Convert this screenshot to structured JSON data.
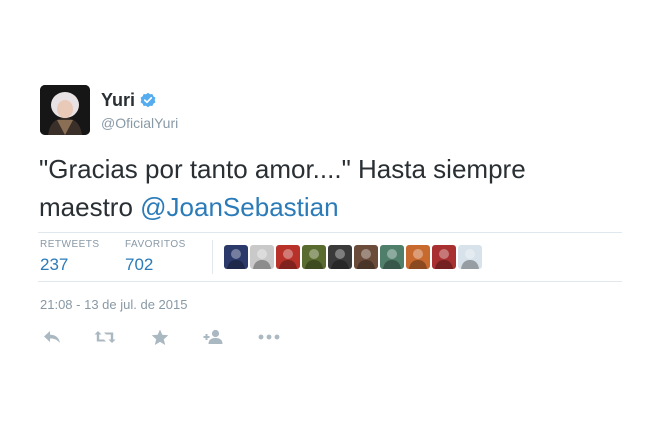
{
  "author": {
    "name": "Yuri",
    "handle": "@OficialYuri",
    "avatar_icon": "profile-photo",
    "verified_icon": "verified-badge-icon"
  },
  "tweet": {
    "text_before": "\"Gracias por tanto amor....\" Hasta siempre maestro ",
    "mention": "@JoanSebastian"
  },
  "stats": {
    "retweets_label": "RETWEETS",
    "retweets_value": "237",
    "favorites_label": "FAVORITOS",
    "favorites_value": "702"
  },
  "favoriters": [
    {
      "color": "#2b3a6b"
    },
    {
      "color": "#c9c9c9"
    },
    {
      "color": "#b8322a"
    },
    {
      "color": "#5a6b2f"
    },
    {
      "color": "#3a3a3a"
    },
    {
      "color": "#6b4c3b"
    },
    {
      "color": "#4f7f6a"
    },
    {
      "color": "#c8692e"
    },
    {
      "color": "#a83030"
    },
    {
      "color": "#d8e2ea"
    }
  ],
  "timestamp": "21:08 - 13 de jul. de 2015",
  "actions": [
    {
      "icon": "reply-icon"
    },
    {
      "icon": "retweet-icon"
    },
    {
      "icon": "favorite-star-icon"
    },
    {
      "icon": "follow-icon"
    },
    {
      "icon": "more-icon"
    }
  ],
  "colors": {
    "link": "#2b7bb9",
    "muted": "#8899a6",
    "text": "#292f33",
    "verified": "#55acee",
    "divider": "#e1e8ed",
    "action_icon": "#aab8c2"
  }
}
